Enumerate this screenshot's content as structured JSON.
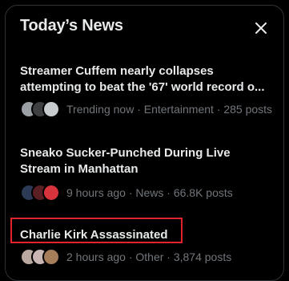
{
  "panel": {
    "title": "Today’s News",
    "close_icon": "close-icon"
  },
  "stories": [
    {
      "headline_line1": "Streamer Cuffem nearly collapses",
      "headline_line2": "attempting to beat the '67' world record o...",
      "meta": "Trending now · Entertainment · 285 posts",
      "avatar_colors": [
        "#9aa0a6",
        "#3c4043",
        "#c8ccd0"
      ]
    },
    {
      "headline_line1": "Sneako Sucker-Punched During Live",
      "headline_line2": "Stream in Manhattan",
      "meta": "9 hours ago · News · 66.8K posts",
      "avatar_colors": [
        "#2b3a55",
        "#5a1f24",
        "#d8343b"
      ]
    },
    {
      "headline_line1": "Charlie Kirk Assassinated",
      "meta": "2 hours ago · Other · 3,874 posts",
      "avatar_colors": [
        "#b9a7a0",
        "#c9b6b2",
        "#a77d5a"
      ]
    }
  ],
  "colors": {
    "background": "#000000",
    "text_primary": "#e7e9ea",
    "text_secondary": "#71767b",
    "highlight": "#e0242a"
  }
}
